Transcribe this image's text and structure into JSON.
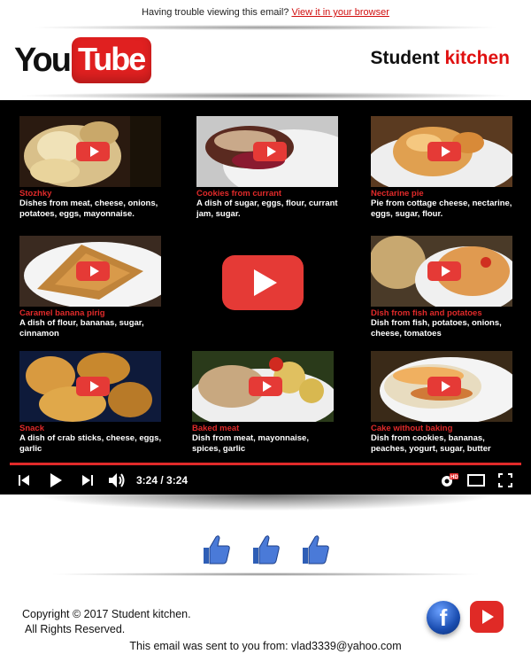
{
  "topbar": {
    "text": "Having trouble viewing this email?",
    "link": "View it in your browser"
  },
  "header": {
    "logo_you": "You",
    "logo_tube": "Tube",
    "brand_student": "Student",
    "brand_kitchen": "kitchen"
  },
  "player": {
    "cards": [
      {
        "title": "Stozhky",
        "desc": "Dishes from meat, cheese, onions, potatoes, eggs, mayonnaise."
      },
      {
        "title": "Cookies from currant",
        "desc": "A dish of sugar, eggs, flour, currant jam, sugar."
      },
      {
        "title": "Nectarine pie",
        "desc": "Pie from cottage cheese, nectarine, eggs, sugar, flour."
      },
      {
        "title": "Caramel banana pirig",
        "desc": "A dish of flour, bananas, sugar, cinnamon"
      },
      {
        "title": "Dish from fish and potatoes",
        "desc": "Dish from fish, potatoes, onions, cheese, tomatoes"
      },
      {
        "title": "Snack",
        "desc": "A dish of crab sticks, cheese, eggs, garlic"
      },
      {
        "title": "Baked meat",
        "desc": "Dish from meat, mayonnaise, spices, garlic"
      },
      {
        "title": "Cake without baking",
        "desc": "Dish from cookies, bananas, peaches, yogurt, sugar, butter"
      }
    ],
    "progress": 1.0,
    "time": "3:24 / 3:24",
    "colors": {
      "accent": "#e12a2a",
      "play": "#e53a36"
    }
  },
  "footer": {
    "copyright_line1": "Copyright © 2017 Student kitchen.",
    "copyright_line2": "All Rights Reserved.",
    "sent_from": "This email was sent to you from: vlad3339@yahoo.com",
    "facebook_letter": "f"
  }
}
